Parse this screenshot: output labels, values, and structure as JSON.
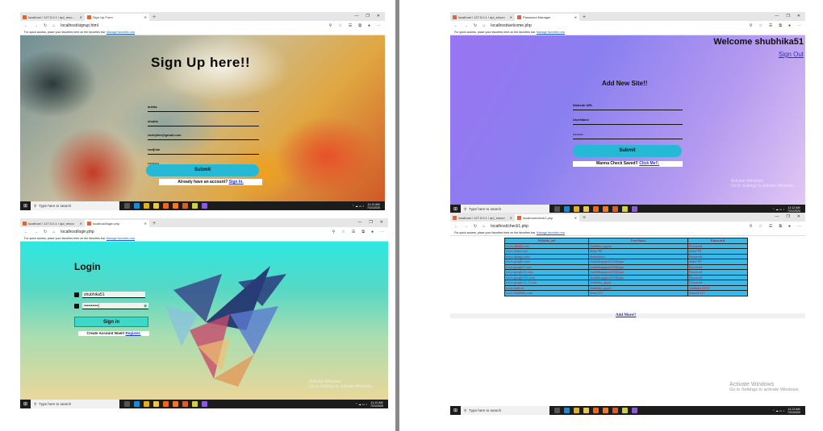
{
  "divider": "",
  "shots": {
    "signup": {
      "tabs": [
        {
          "label": "localhost / 127.0.0.1 / api_reso..."
        },
        {
          "label": "Sign Up Form"
        }
      ],
      "url": "localhost/signup.html",
      "title": "Sign Up here!!",
      "fields": [
        "ankita",
        "shukla",
        "ravinjhim@gmail.com",
        "ravijhim",
        "••••••••••"
      ],
      "button": "Submit",
      "link_prefix": "Already have an account?",
      "link": "Sign In."
    },
    "welcome": {
      "tabs": [
        {
          "label": "localhost / 127.0.0.1 / api_shoon"
        },
        {
          "label": "Password Manager"
        }
      ],
      "url": "localhost/welcome.php",
      "title": "Welcome shubhika51",
      "signout": "Sign Out",
      "subtitle": "Add New Site!!",
      "fields": [
        "Website URL",
        "UserName",
        "•••••••••"
      ],
      "button": "Submit",
      "link_prefix": "Wanna Check Saved!!",
      "link": "Click Me!!.",
      "watermark1": "Activate Windows",
      "watermark2": "Go to Settings to activate Windows."
    },
    "login": {
      "tabs": [
        {
          "label": "localhost / 127.0.0.1 / api_resou"
        },
        {
          "label": "localhost/login.php"
        }
      ],
      "url": "localhost/login.php",
      "title": "Login",
      "username": "shubhika51",
      "password": "••••••••••|",
      "button": "Sign in",
      "link_prefix": "Create Account Now!!",
      "link": "Register.",
      "watermark1": "Activate Windows",
      "watermark2": "Go to Settings to activate Windows."
    },
    "check": {
      "tabs": [
        {
          "label": "localhost / 127.0.0.1 / api_shoon"
        },
        {
          "label": "localhost/check1.php"
        }
      ],
      "url": "localhost/check1.php",
      "columns": [
        "Website_url",
        "UserName",
        "Password"
      ],
      "rows": [
        [
          "www.ddddd.com",
          "shubhika_gupta",
          "Password"
        ],
        [
          "www.demo.com",
          "demo\"89",
          "demo\"89"
        ],
        [
          "www.django.com",
          "demodemo",
          "Password"
        ],
        [
          "www.google.com",
          "shubhikagupta1234@gm",
          "demo\"89"
        ],
        [
          "www.google1.com",
          "shubhikagupta1234@gm",
          "Password"
        ],
        [
          "www.google12.com",
          "shubhikagupta1234@gm",
          "Password"
        ],
        [
          "www.google123.com",
          "shubhikagupta1234@gm",
          "Password"
        ],
        [
          "www.google12_3.com",
          "shubhika_gupta",
          "Password"
        ],
        [
          "www.hade.in",
          "shubhika_gupta",
          "shubhika12345"
        ],
        [
          "www.shubhika.com",
          "demo123",
          "demo@123"
        ]
      ],
      "add_more": "Add More!!",
      "watermark1": "Activate Windows",
      "watermark2": "Go to Settings to activate Windows."
    }
  },
  "common": {
    "favbar_text": "For quick access, place your favorites here on the favorites bar.",
    "favbar_link": "Manage favorites now",
    "taskbar_search": "Type here to search",
    "time": "11:12 AM",
    "date": "7/21/2020"
  }
}
